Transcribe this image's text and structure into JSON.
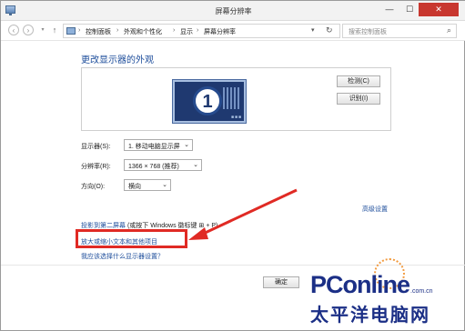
{
  "window": {
    "title": "屏幕分辨率",
    "min": "—",
    "max": "☐",
    "close": "✕"
  },
  "nav": {
    "back": "‹",
    "forward": "›",
    "recent": "▾",
    "up": "↑"
  },
  "breadcrumb": {
    "items": [
      "控制面板",
      "外观和个性化",
      "显示",
      "屏幕分辨率"
    ],
    "separator": "›",
    "dropdown": "▾",
    "refresh": "↻"
  },
  "search": {
    "placeholder": "搜索控制面板",
    "icon": "⌕"
  },
  "main": {
    "heading": "更改显示器的外观",
    "monitor_number": "1",
    "monitor_dots": "■■■",
    "detect_label": "检测(C)",
    "identify_label": "识别(I)",
    "display_label": "显示器(S):",
    "display_value": "1. 移动电脑显示屏",
    "resolution_label": "分辨率(R):",
    "resolution_value": "1366 × 768 (推荐)",
    "orientation_label": "方向(O):",
    "orientation_value": "横向",
    "select_arrow": "⌄",
    "advanced_link": "高级设置",
    "project_link": "投影到第二屏幕",
    "project_hint": " (或按下 Windows 徽标键 ⊞ + P)",
    "bigger_text_link": "放大或缩小文本和其他项目",
    "help_link": "我应该选择什么显示器设置？",
    "ok_label": "确定"
  },
  "watermark": {
    "brand": "PConline",
    "domain": ".com.cn",
    "cn": "太平洋电脑网"
  },
  "colors": {
    "link": "#1d4d9b",
    "highlight": "#e02a24",
    "close": "#c8372f",
    "brand": "#1b2f86"
  }
}
